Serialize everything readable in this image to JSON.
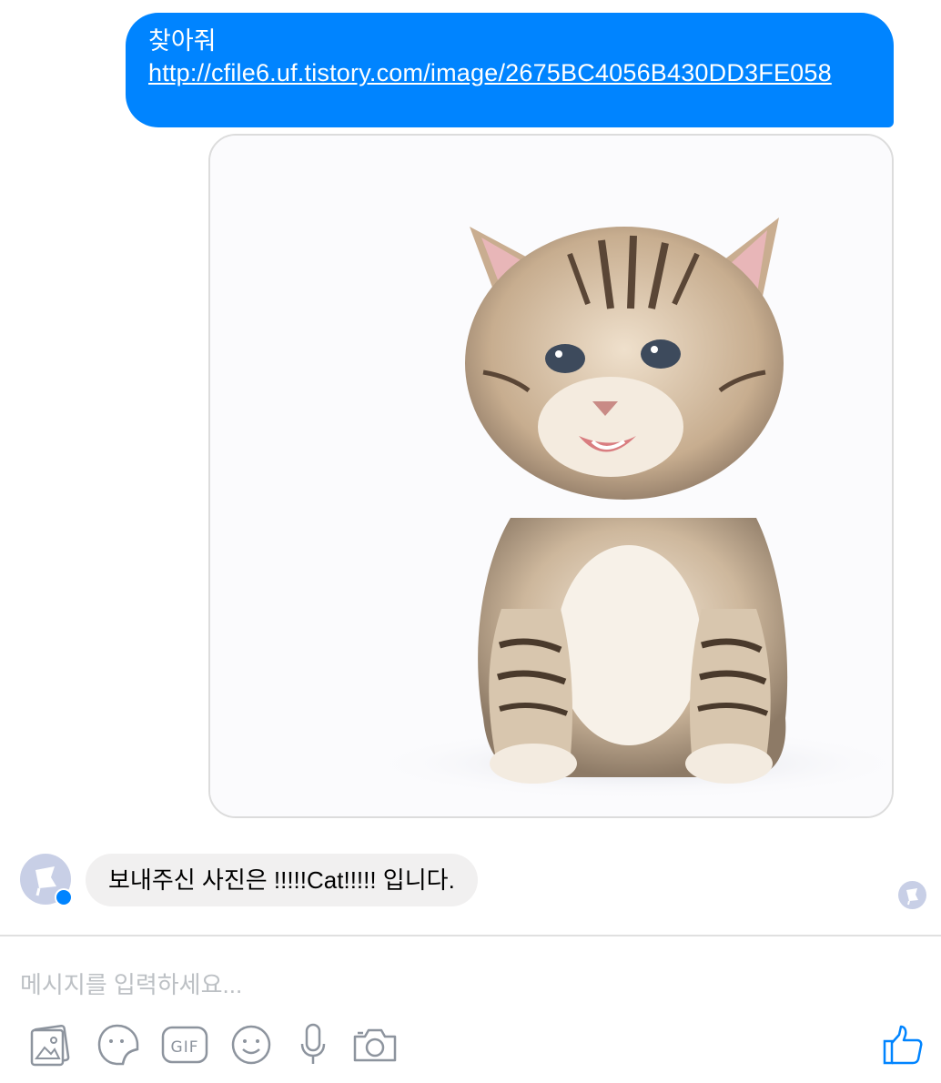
{
  "thread": {
    "outgoing_message": {
      "text": "찾아줘",
      "link": "http://cfile6.uf.tistory.com/image/2675BC4056B430DD3FE058"
    },
    "image_attachment": {
      "description": "kitten"
    },
    "incoming_message": {
      "text": "보내주신 사진은 !!!!!Cat!!!!! 입니다."
    }
  },
  "composer": {
    "placeholder": "메시지를 입력하세요...",
    "tools": [
      "photo-icon",
      "sticker-icon",
      "gif-icon",
      "emoji-icon",
      "microphone-icon",
      "camera-icon"
    ],
    "send": "thumbs-up-icon"
  },
  "colors": {
    "accent": "#0084ff",
    "incoming_bubble": "#f1f0f0",
    "icon_gray": "#8d949e",
    "avatar": "#c8cfe6"
  }
}
